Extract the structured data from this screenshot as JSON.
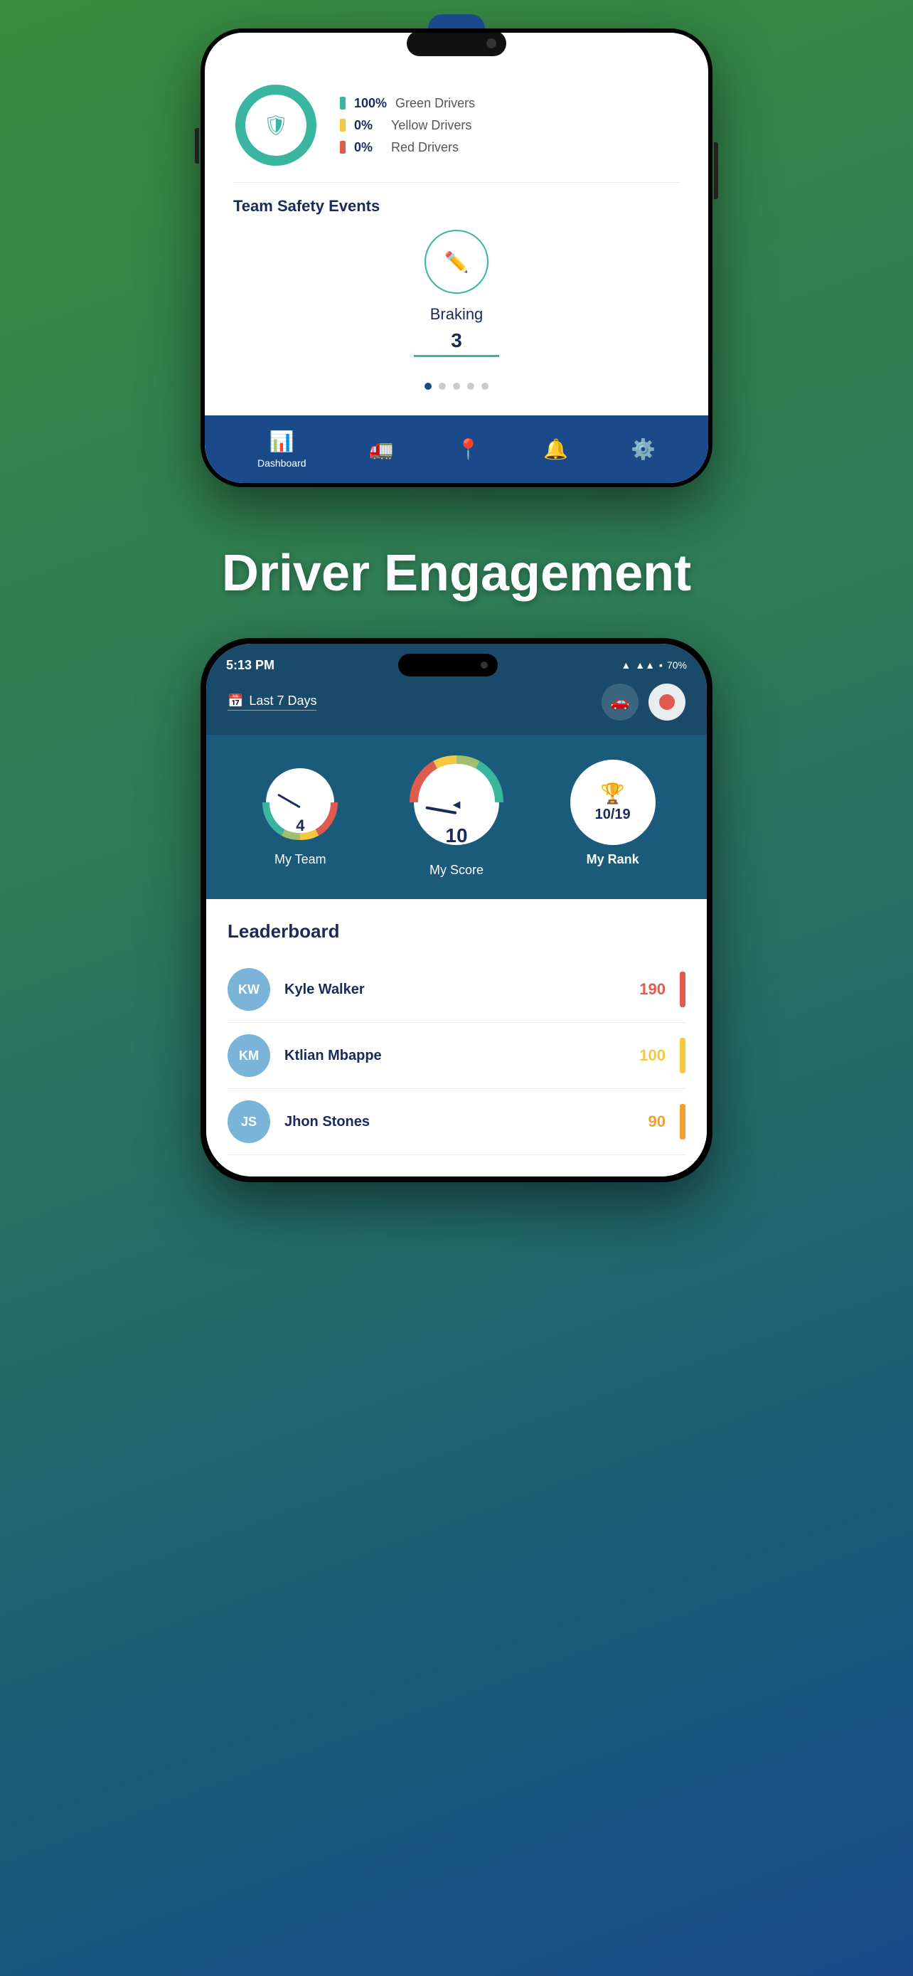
{
  "background": {
    "gradient_start": "#3a8c3f",
    "gradient_end": "#1a4a8a"
  },
  "top_phone": {
    "camera_visible": true,
    "shield": {
      "color": "#3ab5a0"
    },
    "driver_stats": [
      {
        "pct": "100%",
        "label": "Green Drivers",
        "bar_color": "#3ab5a0"
      },
      {
        "pct": "0%",
        "label": "Yellow Drivers",
        "bar_color": "#f5c842"
      },
      {
        "pct": "0%",
        "label": "Red Drivers",
        "bar_color": "#e05a4e"
      }
    ],
    "team_safety": {
      "title": "Team Safety Events",
      "event_name": "Braking",
      "event_value": "3"
    },
    "pagination_dots": 5,
    "active_dot": 0,
    "nav_items": [
      {
        "icon": "📊",
        "label": "Dashboard",
        "active": true
      },
      {
        "icon": "🚛",
        "label": "",
        "active": false
      },
      {
        "icon": "📍",
        "label": "",
        "active": false
      },
      {
        "icon": "🔔",
        "label": "",
        "active": false
      },
      {
        "icon": "⚙️",
        "label": "",
        "active": false
      }
    ]
  },
  "section_heading": "Driver Engagement",
  "bottom_phone": {
    "status_bar": {
      "time": "5:13 PM",
      "wifi_icon": "📶",
      "signal": "▲▲▲",
      "battery": "70%"
    },
    "date_filter": "Last 7 Days",
    "scores": {
      "my_team": {
        "label": "My Team",
        "value": 4,
        "gauge_segments": [
          {
            "color": "#e05a4e",
            "pct": 25
          },
          {
            "color": "#f5c842",
            "pct": 25
          },
          {
            "color": "#a0c070",
            "pct": 25
          },
          {
            "color": "#3ab5a0",
            "pct": 25
          }
        ]
      },
      "my_score": {
        "label": "My Score",
        "value": 10,
        "gauge_segments": [
          {
            "color": "#e05a4e",
            "pct": 25
          },
          {
            "color": "#f5c842",
            "pct": 25
          },
          {
            "color": "#a0c070",
            "pct": 25
          },
          {
            "color": "#3ab5a0",
            "pct": 25
          }
        ]
      },
      "my_rank": {
        "label": "My Rank",
        "value": "10/19",
        "trophy_icon": "🏆"
      }
    },
    "leaderboard": {
      "title": "Leaderboard",
      "entries": [
        {
          "initials": "KW",
          "name": "Kyle Walker",
          "score": 190,
          "score_color": "#e05a4e",
          "bar_color": "#e05a4e"
        },
        {
          "initials": "KM",
          "name": "Ktlian Mbappe",
          "score": 100,
          "score_color": "#f5c842",
          "bar_color": "#f5c842"
        },
        {
          "initials": "JS",
          "name": "Jhon Stones",
          "score": 90,
          "score_color": "#f0a030",
          "bar_color": "#f0a030"
        }
      ]
    }
  }
}
